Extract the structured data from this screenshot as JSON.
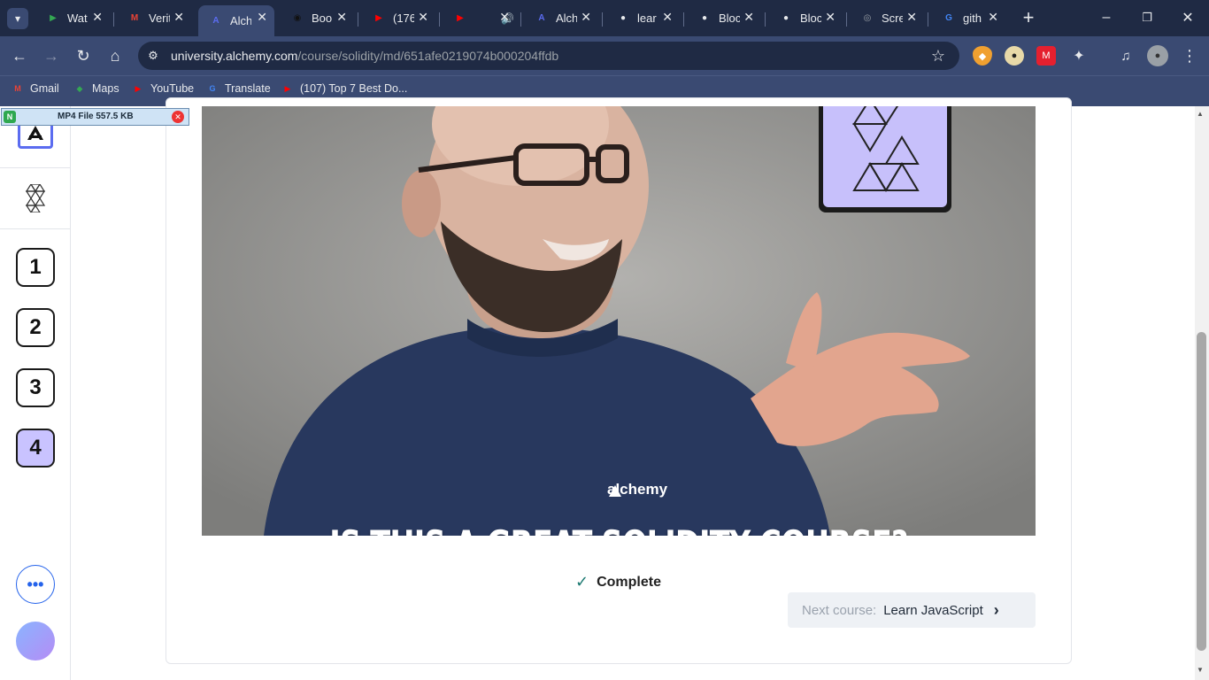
{
  "browser": {
    "tabs": [
      {
        "label": "Wat",
        "icon": "play-icon",
        "color": "#34a853"
      },
      {
        "label": "Verit",
        "icon": "gmail-icon",
        "color": "#ea4335"
      },
      {
        "label": "Alch",
        "icon": "alchemy-icon",
        "color": "#5b6cf0"
      },
      {
        "label": "Boo",
        "icon": "bot-icon",
        "color": "#111111"
      },
      {
        "label": "(176",
        "icon": "youtube-icon",
        "color": "#ff0000"
      },
      {
        "label": "",
        "icon": "youtube-icon",
        "color": "#ff0000"
      },
      {
        "label": "Alch",
        "icon": "alchemy-icon",
        "color": "#5b6cf0"
      },
      {
        "label": "lear",
        "icon": "github-icon",
        "color": "#e8eaed"
      },
      {
        "label": "Bloc",
        "icon": "github-icon",
        "color": "#e8eaed"
      },
      {
        "label": "Bloc",
        "icon": "github-icon",
        "color": "#e8eaed"
      },
      {
        "label": "Scre",
        "icon": "globe-icon",
        "color": "#9aa0a6"
      },
      {
        "label": "gith",
        "icon": "google-icon",
        "color": "#4285f4"
      }
    ],
    "url_domain": "university.alchemy.com",
    "url_path": "/course/solidity/md/651afe0219074b000204ffdb",
    "bookmarks": [
      {
        "label": "Gmail",
        "icon": "gmail-icon",
        "color": "#ea4335"
      },
      {
        "label": "Maps",
        "icon": "maps-icon",
        "color": "#34a853"
      },
      {
        "label": "YouTube",
        "icon": "youtube-icon",
        "color": "#ff0000"
      },
      {
        "label": "Translate",
        "icon": "translate-icon",
        "color": "#4285f4"
      },
      {
        "label": "(107) Top 7 Best Do...",
        "icon": "youtube-icon",
        "color": "#ff0000"
      }
    ]
  },
  "download": {
    "label": "MP4 File 557.5 KB"
  },
  "sidebar": {
    "steps": [
      "1",
      "2",
      "3",
      "4"
    ],
    "active_step": "4",
    "active_color": "#c9c3ff"
  },
  "video": {
    "caption": "IS THIS A GREAT SOLIDITY COURSE?",
    "shirt_text": "alchemy"
  },
  "lesson": {
    "complete_label": "Complete",
    "next_label": "Next course:",
    "next_course": "Learn JavaScript"
  }
}
